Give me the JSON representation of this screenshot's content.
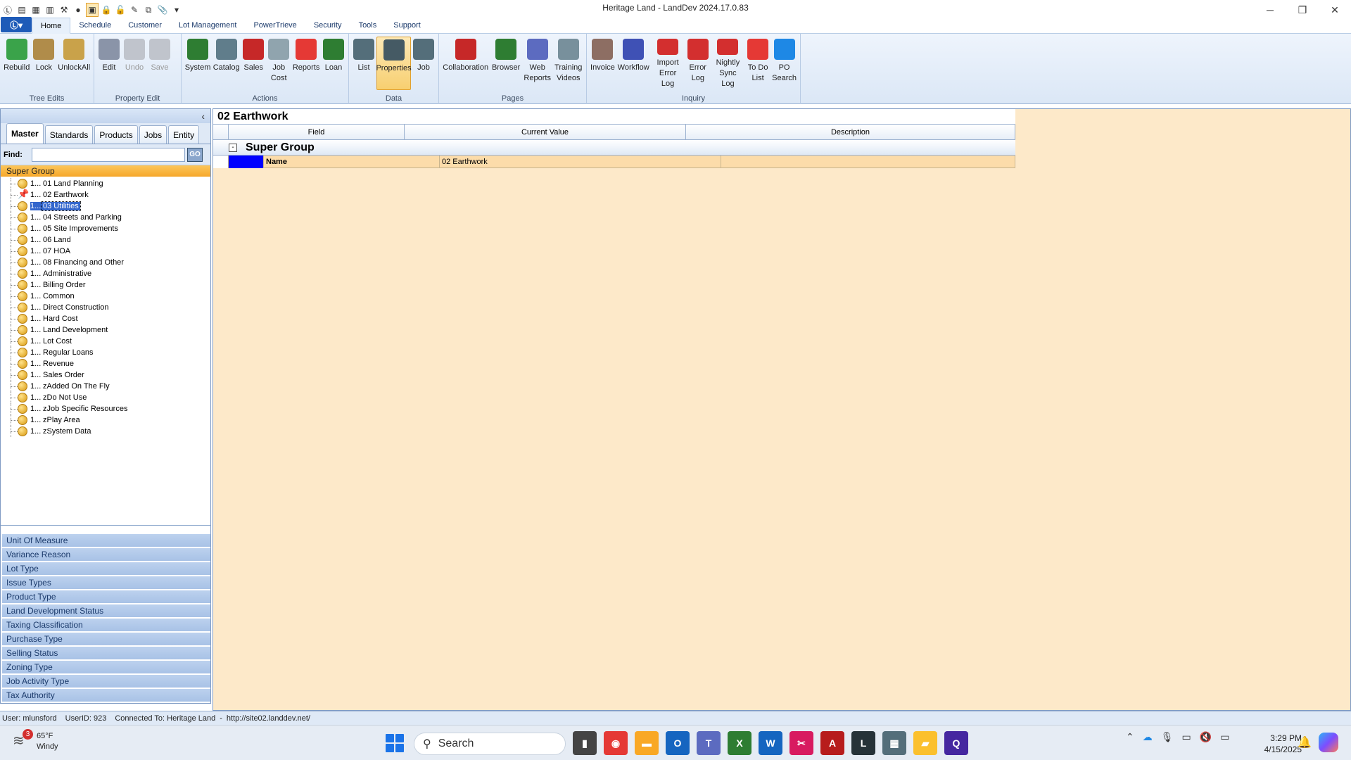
{
  "window": {
    "title": "Heritage Land - LandDev 2024.17.0.83"
  },
  "qat": {
    "icons": [
      "app-logo-icon",
      "sheet-icon",
      "calendar-icon",
      "clipboard-icon",
      "tractor-icon",
      "globe-icon",
      "window-icon",
      "lock-icon",
      "unlock-icon",
      "edit-icon",
      "copy-icon",
      "paperclip-icon",
      "dropdown-icon"
    ]
  },
  "ribbon": {
    "app_menu_label": "Ⓛ▾",
    "tabs": [
      "Home",
      "Schedule",
      "Customer",
      "Lot Management",
      "PowerTrieve",
      "Security",
      "Tools",
      "Support"
    ],
    "groups": [
      {
        "label": "Tree Edits",
        "buttons": [
          {
            "label": "Rebuild",
            "icon": "recycle-icon",
            "color": "#3aa34a"
          },
          {
            "label": "Lock",
            "icon": "lock-icon",
            "color": "#b08c4a"
          },
          {
            "label": "UnlockAll",
            "icon": "unlock-all-icon",
            "color": "#c9a24a"
          }
        ]
      },
      {
        "label": "Property Edit",
        "buttons": [
          {
            "label": "Edit",
            "icon": "pencil-icon",
            "color": "#8a94a8"
          },
          {
            "label": "Undo",
            "icon": "undo-icon",
            "color": "#c0c4cc",
            "disabled": true
          },
          {
            "label": "Save",
            "icon": "save-icon",
            "color": "#c0c4cc",
            "disabled": true
          }
        ]
      },
      {
        "label": "Actions",
        "buttons": [
          {
            "label": "System",
            "icon": "globe-icon",
            "color": "#2e7d32"
          },
          {
            "label": "Catalog",
            "icon": "cart-icon",
            "color": "#607d8b"
          },
          {
            "label": "Sales",
            "icon": "house-icon",
            "color": "#c62828"
          },
          {
            "label": "Job\nCost",
            "icon": "document-icon",
            "color": "#90a4ae"
          },
          {
            "label": "Reports",
            "icon": "chart-icon",
            "color": "#e53935"
          },
          {
            "label": "Loan",
            "icon": "bank-icon",
            "color": "#2e7d32"
          }
        ]
      },
      {
        "label": "Data",
        "buttons": [
          {
            "label": "List",
            "icon": "list-icon",
            "color": "#546e7a"
          },
          {
            "label": "Properties",
            "icon": "properties-icon",
            "color": "#455a64",
            "active": true
          },
          {
            "label": "Job",
            "icon": "job-icon",
            "color": "#546e7a"
          }
        ]
      },
      {
        "label": "Pages",
        "buttons": [
          {
            "label": "Collaboration",
            "icon": "collaboration-icon",
            "color": "#c62828"
          },
          {
            "label": "Browser",
            "icon": "browser-icon",
            "color": "#2e7d32"
          },
          {
            "label": "Web\nReports",
            "icon": "web-reports-icon",
            "color": "#5c6bc0"
          },
          {
            "label": "Training\nVideos",
            "icon": "video-icon",
            "color": "#78909c"
          }
        ]
      },
      {
        "label": "Inquiry",
        "buttons": [
          {
            "label": "Invoice",
            "icon": "invoice-icon",
            "color": "#8d6e63"
          },
          {
            "label": "Workflow",
            "icon": "workflow-icon",
            "color": "#3f51b5"
          },
          {
            "label": "Import\nError Log",
            "icon": "import-log-icon",
            "color": "#d32f2f"
          },
          {
            "label": "Error\nLog",
            "icon": "error-log-icon",
            "color": "#d32f2f"
          },
          {
            "label": "Nightly\nSync Log",
            "icon": "sync-log-icon",
            "color": "#d32f2f"
          },
          {
            "label": "To Do\nList",
            "icon": "todo-icon",
            "color": "#e53935"
          },
          {
            "label": "PO\nSearch",
            "icon": "magnifier-icon",
            "color": "#1e88e5"
          }
        ]
      }
    ]
  },
  "left_pane": {
    "tabs": [
      "Master",
      "Standards",
      "Products",
      "Jobs",
      "Entity"
    ],
    "find_label": "Find:",
    "find_value": "",
    "go_label": "GO",
    "section_header": "Super Group",
    "tree_items": [
      {
        "code": "1...",
        "label": "01 Land Planning"
      },
      {
        "code": "1...",
        "label": "02 Earthwork",
        "pinned": true
      },
      {
        "code": "1...",
        "label": "03 Utilities",
        "selected": true
      },
      {
        "code": "1...",
        "label": "04 Streets and Parking"
      },
      {
        "code": "1...",
        "label": "05 Site Improvements"
      },
      {
        "code": "1...",
        "label": "06 Land"
      },
      {
        "code": "1...",
        "label": "07 HOA"
      },
      {
        "code": "1...",
        "label": "08 Financing and Other"
      },
      {
        "code": "1...",
        "label": "Administrative"
      },
      {
        "code": "1...",
        "label": "Billing Order"
      },
      {
        "code": "1...",
        "label": "Common"
      },
      {
        "code": "1...",
        "label": "Direct Construction"
      },
      {
        "code": "1...",
        "label": "Hard Cost"
      },
      {
        "code": "1...",
        "label": "Land Development"
      },
      {
        "code": "1...",
        "label": "Lot Cost"
      },
      {
        "code": "1...",
        "label": "Regular Loans"
      },
      {
        "code": "1...",
        "label": "Revenue"
      },
      {
        "code": "1...",
        "label": "Sales Order"
      },
      {
        "code": "1...",
        "label": "zAdded On The Fly"
      },
      {
        "code": "1...",
        "label": "zDo Not Use"
      },
      {
        "code": "1...",
        "label": "zJob Specific Resources"
      },
      {
        "code": "1...",
        "label": "zPlay Area"
      },
      {
        "code": "1...",
        "label": "zSystem Data"
      }
    ],
    "lookups": [
      "Unit Of Measure",
      "Variance Reason",
      "Lot Type",
      "Issue Types",
      "Product Type",
      "Land Development Status",
      "Taxing Classification",
      "Purchase Type",
      "Selling Status",
      "Zoning Type",
      "Job Activity Type",
      "Tax Authority"
    ]
  },
  "main": {
    "title": "02 Earthwork",
    "columns": [
      "Field",
      "Current Value",
      "Description"
    ],
    "group_title": "Super Group",
    "expander": "-",
    "rows": [
      {
        "field": "Name",
        "value": "02 Earthwork",
        "description": ""
      }
    ]
  },
  "status_bar": {
    "user": "User: mlunsford",
    "user_id": "UserID: 923",
    "connected": "Connected To: Heritage Land",
    "url": "http://site02.landdev.net/"
  },
  "taskbar": {
    "weather_badge": "3",
    "temperature": "65°F",
    "condition": "Windy",
    "search_label": "Search",
    "apps": [
      {
        "name": "file-explorer-dark-icon",
        "glyph": "▮",
        "color": "#444"
      },
      {
        "name": "chrome-icon",
        "glyph": "◉",
        "color": "#e53935"
      },
      {
        "name": "folder-icon",
        "glyph": "▬",
        "color": "#f9a825"
      },
      {
        "name": "outlook-icon",
        "glyph": "O",
        "color": "#1565c0"
      },
      {
        "name": "teams-icon",
        "glyph": "T",
        "color": "#5c6bc0"
      },
      {
        "name": "excel-icon",
        "glyph": "X",
        "color": "#2e7d32"
      },
      {
        "name": "word-icon",
        "glyph": "W",
        "color": "#1565c0"
      },
      {
        "name": "snipping-icon",
        "glyph": "✂",
        "color": "#d81b60"
      },
      {
        "name": "access-icon",
        "glyph": "A",
        "color": "#b71c1c"
      },
      {
        "name": "landdev-icon",
        "glyph": "L",
        "color": "#263238"
      },
      {
        "name": "calculator-icon",
        "glyph": "▦",
        "color": "#546e7a"
      },
      {
        "name": "sticky-notes-icon",
        "glyph": "▰",
        "color": "#fbc02d"
      },
      {
        "name": "quick-assist-icon",
        "glyph": "Q",
        "color": "#4527a0"
      }
    ],
    "time": "3:29 PM",
    "date": "4/15/2025"
  }
}
